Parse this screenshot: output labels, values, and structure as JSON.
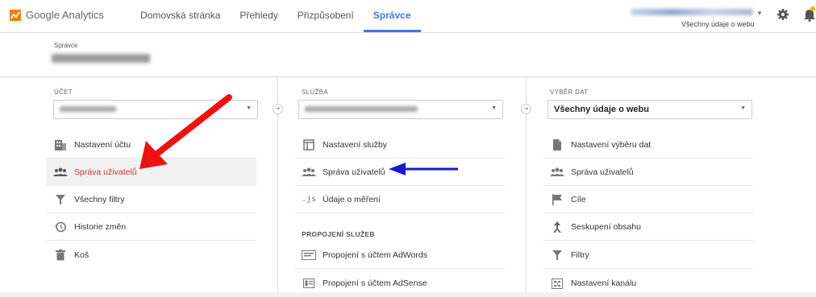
{
  "app": {
    "logo_text": "Google Analytics"
  },
  "nav": {
    "items": [
      "Domovská stránka",
      "Přehledy",
      "Přizpůsobení",
      "Správce"
    ],
    "active_index": 3
  },
  "account_switcher": {
    "sub_label": "Všechny údaje o webu"
  },
  "header": {
    "label": "Správce"
  },
  "columns": {
    "account": {
      "label": "ÚČET",
      "items": [
        "Nastavení účtu",
        "Správa uživatelů",
        "Všechny filtry",
        "Historie změn",
        "Koš"
      ],
      "active_index": 1
    },
    "property": {
      "label": "SLUŽBA",
      "items": [
        "Nastavení služby",
        "Správa uživatelů",
        "Údaje o měření"
      ],
      "section_label": "PROPOJENÍ SLUŽEB",
      "section_items": [
        "Propojení s účtem AdWords",
        "Propojení s účtem AdSense"
      ]
    },
    "view": {
      "label": "VÝBĚR DAT",
      "selected": "Všechny údaje o webu",
      "items": [
        "Nastavení výběru dat",
        "Správa uživatelů",
        "Cíle",
        "Seskupení obsahu",
        "Filtry",
        "Nastavení kanálu"
      ]
    }
  },
  "colors": {
    "accent": "#3b78e7",
    "active_text": "#c53929",
    "red_arrow": "#ee1111",
    "blue_arrow": "#1a1acc"
  },
  "icons": [
    "analytics-logo",
    "gear-icon",
    "bell-icon",
    "building-icon",
    "users-icon",
    "filter-icon",
    "history-icon",
    "trash-icon",
    "window-icon",
    "js-icon",
    "document-icon",
    "flag-icon",
    "content-grouping-icon",
    "adwords-icon",
    "adsense-icon",
    "channel-icon"
  ]
}
